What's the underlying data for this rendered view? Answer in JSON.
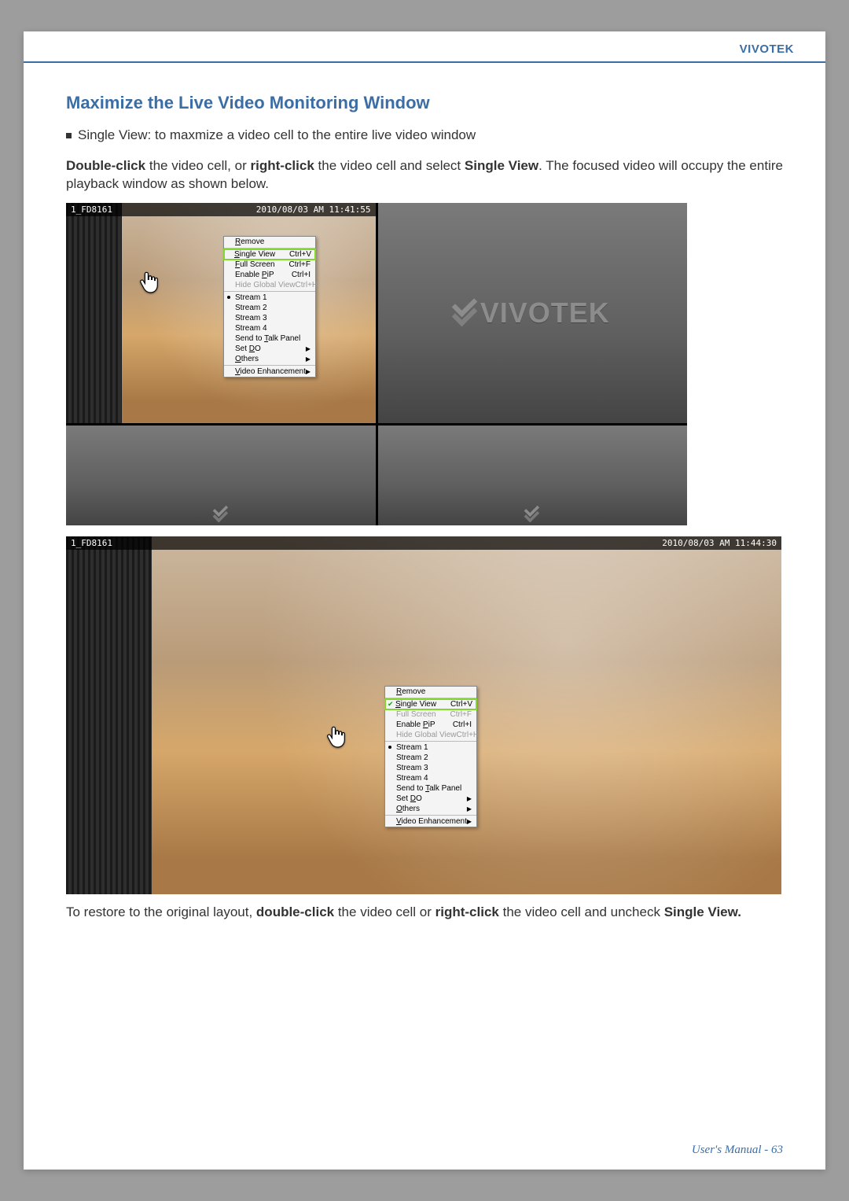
{
  "brand": "VIVOTEK",
  "section_title": "Maximize the Live Video Monitoring Window",
  "bullet_text": "Single View: to maxmize a video cell to the entire live video window",
  "para1_parts": {
    "a": "Double-click",
    "b": " the video cell, or ",
    "c": "right-click",
    "d": " the video cell and select ",
    "e": "Single View",
    "f": ". The focused video will occupy the entire playback window as shown below."
  },
  "para2_parts": {
    "a": "To restore to the original layout, ",
    "b": "double-click",
    "c": " the video cell or ",
    "d": "right-click",
    "e": " the video cell and uncheck ",
    "f": "Single View."
  },
  "screenshot1": {
    "camera_id": "1_FD8161",
    "timestamp": "2010/08/03 AM 11:41:55",
    "logo_text": "VIVOTEK"
  },
  "screenshot2": {
    "camera_id": "1_FD8161",
    "timestamp": "2010/08/03 AM 11:44:30"
  },
  "menu": {
    "remove": "Remove",
    "single_view": "Single View",
    "sv_shortcut": "Ctrl+V",
    "full_screen": "Full Screen",
    "fs_shortcut": "Ctrl+F",
    "enable_pip": "Enable PiP",
    "pip_shortcut": "Ctrl+I",
    "hide_global": "Hide Global View",
    "hg_shortcut": "Ctrl+H",
    "stream1": "Stream 1",
    "stream2": "Stream 2",
    "stream3": "Stream 3",
    "stream4": "Stream 4",
    "send_talk": "Send to Talk Panel",
    "set_do": "Set DO",
    "others": "Others",
    "video_enh": "Video Enhancement"
  },
  "footer": {
    "label": "User's Manual - ",
    "page": "63"
  }
}
